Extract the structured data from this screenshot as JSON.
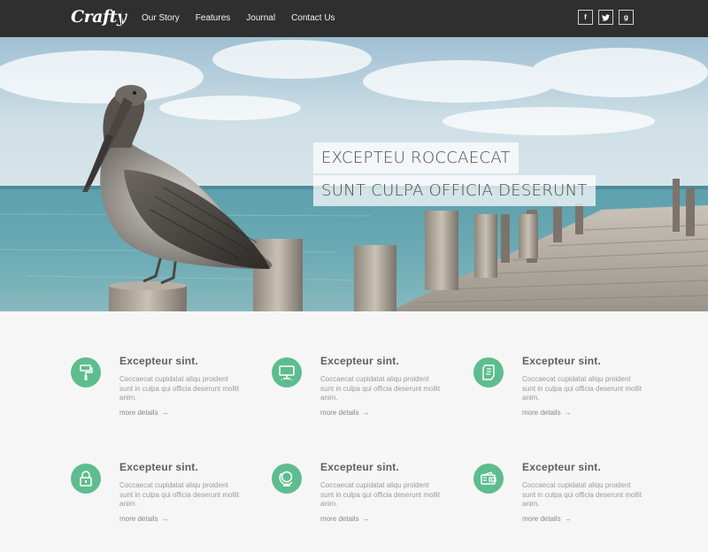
{
  "nav": {
    "logo": "Crafty",
    "menu": [
      {
        "label": "Our Story"
      },
      {
        "label": "Features"
      },
      {
        "label": "Journal"
      },
      {
        "label": "Contact Us"
      }
    ],
    "social": [
      {
        "icon": "facebook-icon",
        "glyph": "f"
      },
      {
        "icon": "twitter-icon",
        "glyph": "t"
      },
      {
        "icon": "google-plus-icon",
        "glyph": "g"
      }
    ]
  },
  "hero": {
    "caption_line1": "EXCEPTEU ROCCAECAT",
    "caption_line2": "SUNT CULPA OFFICIA DESERUNT"
  },
  "features": [
    {
      "icon": "paint-roller-icon",
      "title": "Excepteur sint.",
      "text": "Coccaecat cupidatat aliqu proident sunt in culpa qui officia deserunt mollit anim.",
      "link": "more details",
      "arrow": "→"
    },
    {
      "icon": "monitor-icon",
      "title": "Excepteur sint.",
      "text": "Coccaecat cupidatat aliqu proident sunt in culpa qui officia deserunt mollit anim.",
      "link": "more details",
      "arrow": "→"
    },
    {
      "icon": "document-icon",
      "title": "Excepteur sint.",
      "text": "Coccaecat cupidatat aliqu proident sunt in culpa qui officia deserunt mollit anim.",
      "link": "more details",
      "arrow": "→"
    },
    {
      "icon": "padlock-icon",
      "title": "Excepteur sint.",
      "text": "Coccaecat cupidatat aliqu proident sunt in culpa qui officia deserunt mollit anim.",
      "link": "more details",
      "arrow": "→"
    },
    {
      "icon": "globe-icon",
      "title": "Excepteur sint.",
      "text": "Coccaecat cupidatat aliqu proident sunt in culpa qui officia deserunt mollit anim.",
      "link": "more details",
      "arrow": "→"
    },
    {
      "icon": "wallet-icon",
      "title": "Excepteur sint.",
      "text": "Coccaecat cupidatat aliqu proident sunt in culpa qui officia deserunt mollit anim.",
      "link": "more details",
      "arrow": "→"
    }
  ],
  "colors": {
    "nav_bg": "#2f2f2f",
    "accent": "#5dbd8f",
    "page_bg": "#f6f6f6"
  }
}
